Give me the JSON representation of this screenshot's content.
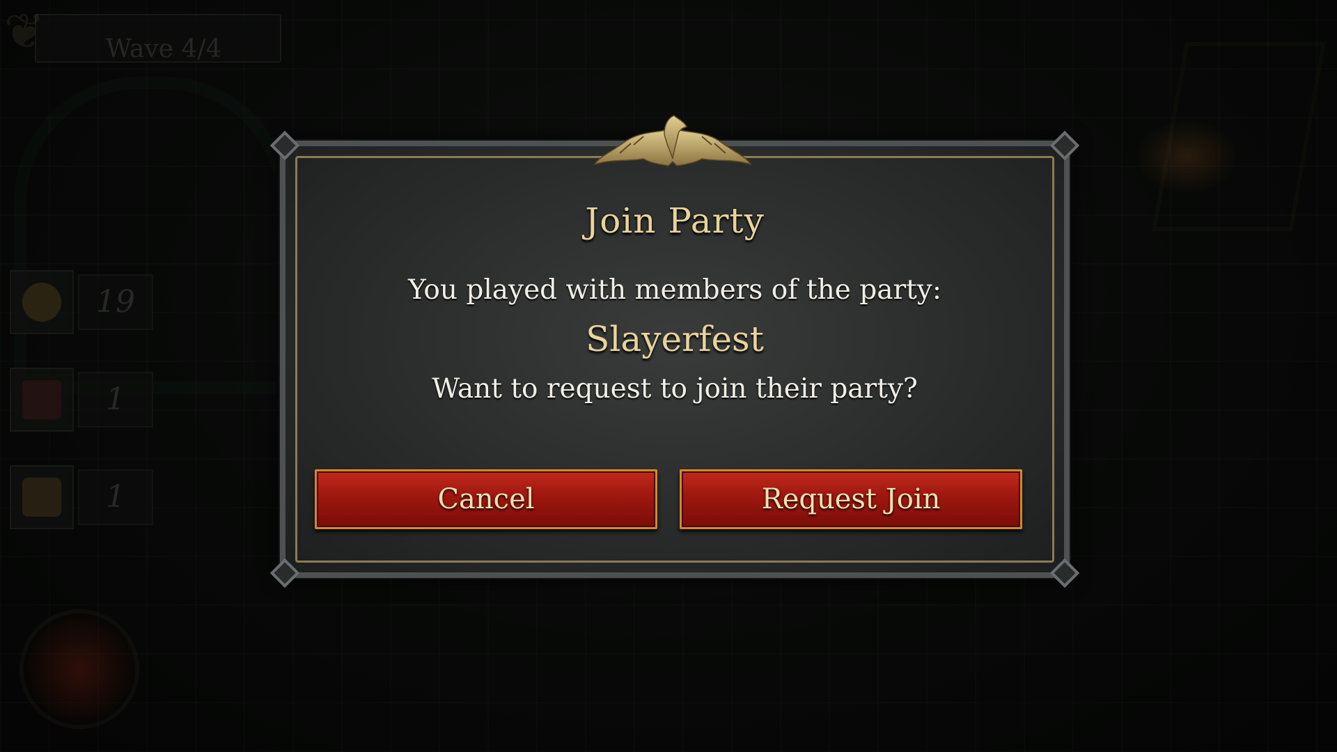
{
  "hud": {
    "wave_label": "Wave 4/4",
    "resources": [
      {
        "icon": "gold-coin-icon",
        "count": "19"
      },
      {
        "icon": "treasure-chest-icon",
        "count": "1"
      },
      {
        "icon": "scroll-icon",
        "count": "1"
      }
    ]
  },
  "dialog": {
    "title": "Join Party",
    "message_line1": "You played with members of the party:",
    "party_name": "Slayerfest",
    "message_line2": "Want to request to join their party?",
    "cancel_label": "Cancel",
    "request_label": "Request Join"
  },
  "colors": {
    "title_gold": "#e8d49a",
    "button_red": "#9d170f",
    "frame_gold": "#8a7c55"
  }
}
